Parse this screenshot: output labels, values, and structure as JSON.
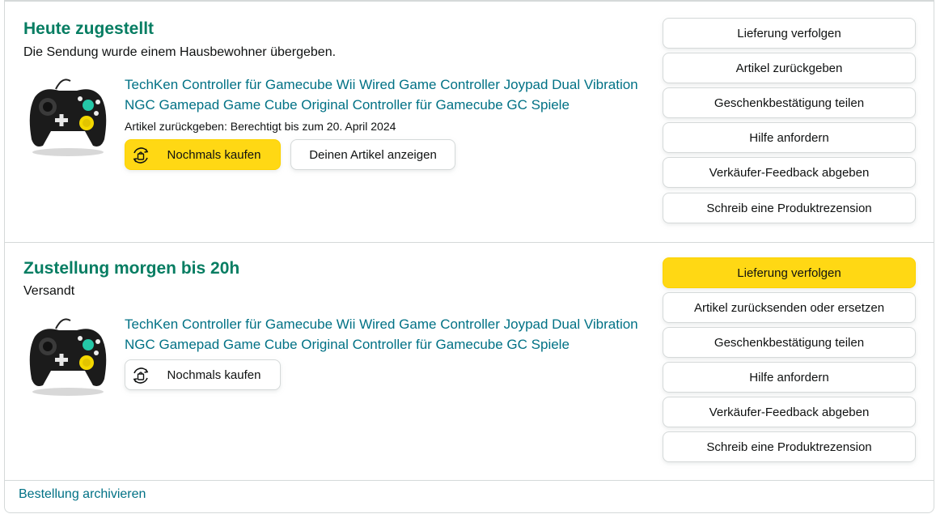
{
  "shipments": [
    {
      "status_title": "Heute zugestellt",
      "status_sub": "Die Sendung wurde einem Hausbewohner übergeben.",
      "product": {
        "title": "TechKen Controller für Gamecube Wii Wired Game Controller Joypad Dual Vibration NGC Gamepad Game Cube Original Controller für Gamecube GC Spiele",
        "image_icon": "gamecube-controller-image"
      },
      "return_note": "Artikel zurückgeben: Berechtigt bis zum 20. April 2024",
      "buy_again_label": "Nochmals kaufen",
      "view_item_label": "Deinen Artikel anzeigen",
      "actions": [
        "Lieferung verfolgen",
        "Artikel zurückgeben",
        "Geschenkbestätigung teilen",
        "Hilfe anfordern",
        "Verkäufer-Feedback abgeben",
        "Schreib eine Produktrezension"
      ]
    },
    {
      "status_title": "Zustellung morgen bis 20h",
      "status_sub": "Versandt",
      "product": {
        "title": "TechKen Controller für Gamecube Wii Wired Game Controller Joypad Dual Vibration NGC Gamepad Game Cube Original Controller für Gamecube GC Spiele",
        "image_icon": "gamecube-controller-image"
      },
      "buy_again_label": "Nochmals kaufen",
      "actions": [
        "Lieferung verfolgen",
        "Artikel zurücksenden oder ersetzen",
        "Geschenkbestätigung teilen",
        "Hilfe anfordern",
        "Verkäufer-Feedback abgeben",
        "Schreib eine Produktrezension"
      ]
    }
  ],
  "footer": {
    "archive_label": "Bestellung archivieren"
  },
  "colors": {
    "status_green": "#067d62",
    "link_teal": "#007185",
    "primary_yellow": "#ffd814",
    "border_gray": "#d5d9d9"
  }
}
